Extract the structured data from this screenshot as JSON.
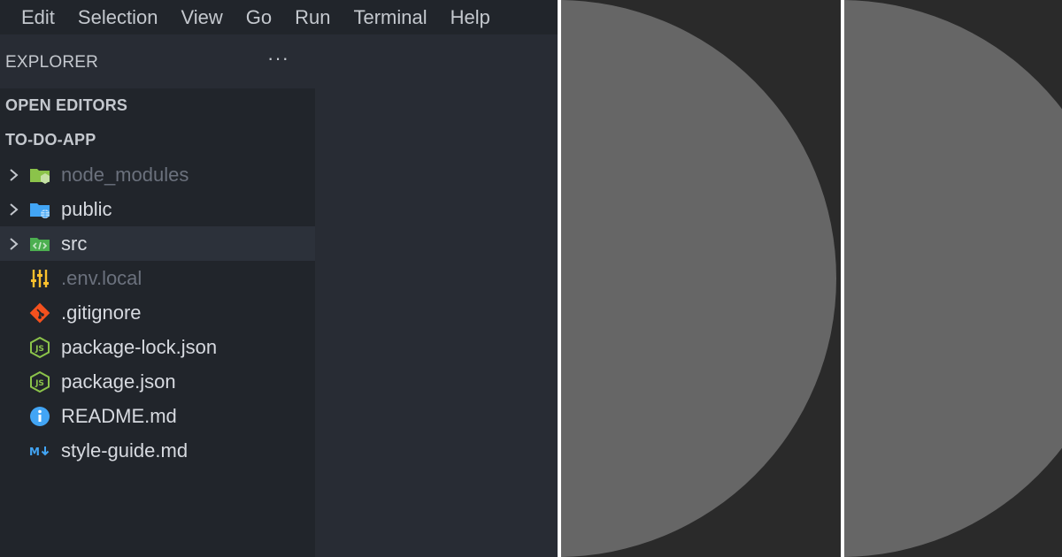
{
  "menu": [
    "Edit",
    "Selection",
    "View",
    "Go",
    "Run",
    "Terminal",
    "Help"
  ],
  "explorer": {
    "title": "EXPLORER",
    "more": "···",
    "open_editors": "OPEN EDITORS",
    "project": "TO-DO-APP"
  },
  "files": [
    {
      "name": "node_modules",
      "kind": "folder",
      "icon": "node-folder-icon",
      "dimmed": true,
      "selected": false
    },
    {
      "name": "public",
      "kind": "folder",
      "icon": "public-folder-icon",
      "dimmed": false,
      "selected": false
    },
    {
      "name": "src",
      "kind": "folder",
      "icon": "src-folder-icon",
      "dimmed": false,
      "selected": true
    },
    {
      "name": ".env.local",
      "kind": "file",
      "icon": "settings-sliders-icon",
      "dimmed": true,
      "selected": false
    },
    {
      "name": ".gitignore",
      "kind": "file",
      "icon": "git-icon",
      "dimmed": false,
      "selected": false
    },
    {
      "name": "package-lock.json",
      "kind": "file",
      "icon": "nodejs-icon",
      "dimmed": false,
      "selected": false
    },
    {
      "name": "package.json",
      "kind": "file",
      "icon": "nodejs-icon",
      "dimmed": false,
      "selected": false
    },
    {
      "name": "README.md",
      "kind": "file",
      "icon": "info-icon",
      "dimmed": false,
      "selected": false
    },
    {
      "name": "style-guide.md",
      "kind": "file",
      "icon": "markdown-icon",
      "dimmed": false,
      "selected": false
    }
  ],
  "colors": {
    "menubar": "#21252b",
    "sidebar": "#21252b",
    "editor": "#282c34",
    "panel_bg": "#2a2a2a",
    "disc": "#666666",
    "divider": "#ffffff"
  },
  "panels": [
    {
      "shape": "half-circle"
    },
    {
      "shape": "half-circle"
    }
  ]
}
